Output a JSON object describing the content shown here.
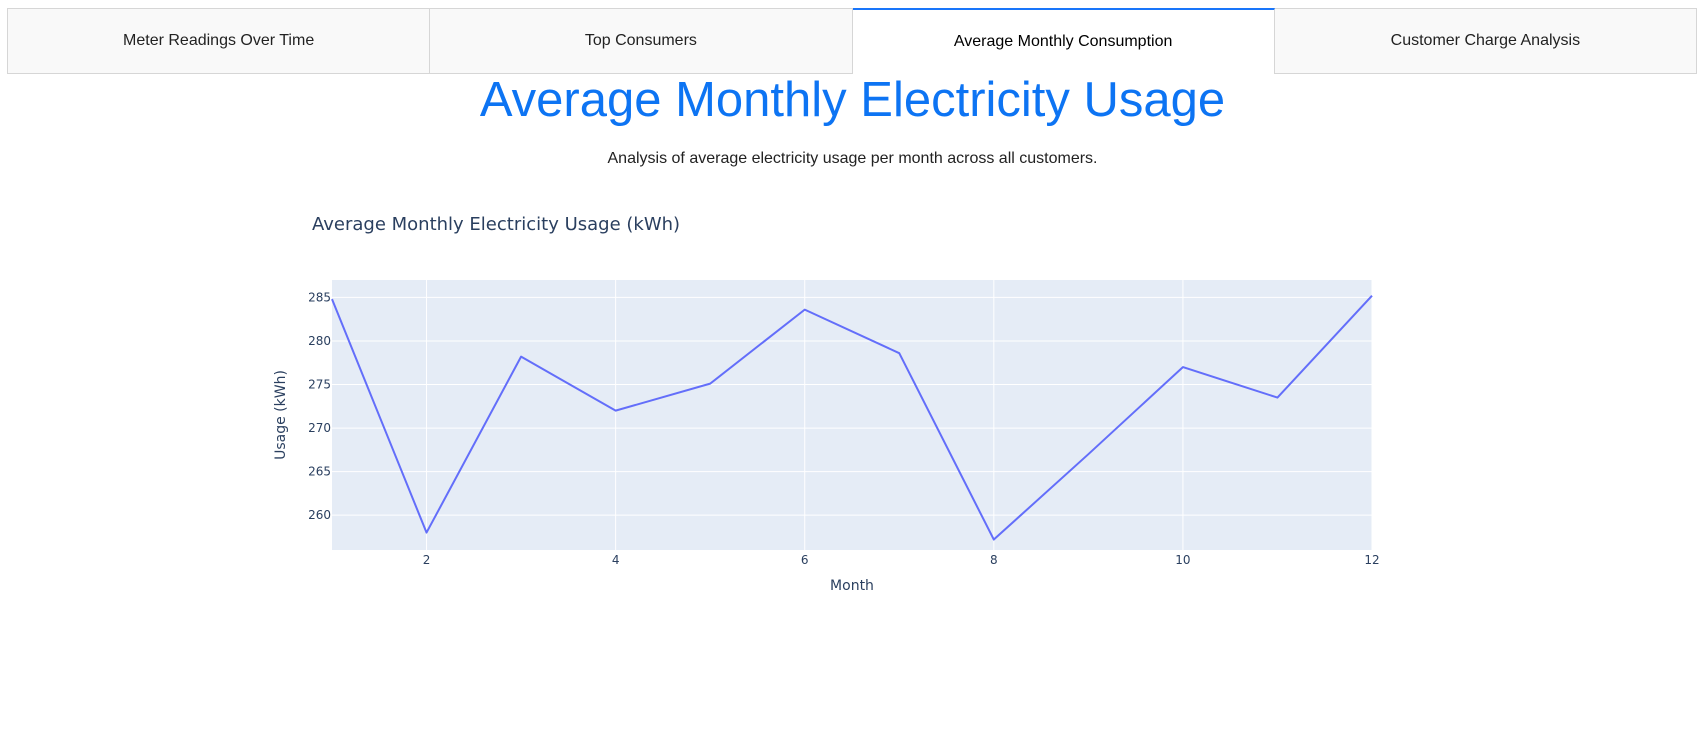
{
  "tabs": [
    {
      "label": "Meter Readings Over Time",
      "selected": false
    },
    {
      "label": "Top Consumers",
      "selected": false
    },
    {
      "label": "Average Monthly Consumption",
      "selected": true
    },
    {
      "label": "Customer Charge Analysis",
      "selected": false
    }
  ],
  "page": {
    "title": "Average Monthly Electricity Usage",
    "subtitle": "Analysis of average electricity usage per month across all customers."
  },
  "colors": {
    "accent": "#0d74f3",
    "plot_bg": "#e5ecf6",
    "line": "#636efa",
    "grid": "#ffffff"
  },
  "chart_data": {
    "type": "line",
    "title": "Average Monthly Electricity Usage (kWh)",
    "xlabel": "Month",
    "ylabel": "Usage (kWh)",
    "xlim": [
      1,
      12
    ],
    "ylim": [
      256,
      287
    ],
    "x_ticks": [
      2,
      4,
      6,
      8,
      10,
      12
    ],
    "y_ticks": [
      260,
      265,
      270,
      275,
      280,
      285
    ],
    "grid": true,
    "series": [
      {
        "x": [
          1,
          2,
          3,
          4,
          5,
          6,
          7,
          8,
          9,
          10,
          11,
          12
        ],
        "values": [
          284.8,
          258.0,
          278.2,
          272.0,
          275.1,
          283.6,
          278.6,
          257.2,
          267.0,
          277.0,
          273.5,
          285.2
        ]
      }
    ]
  }
}
